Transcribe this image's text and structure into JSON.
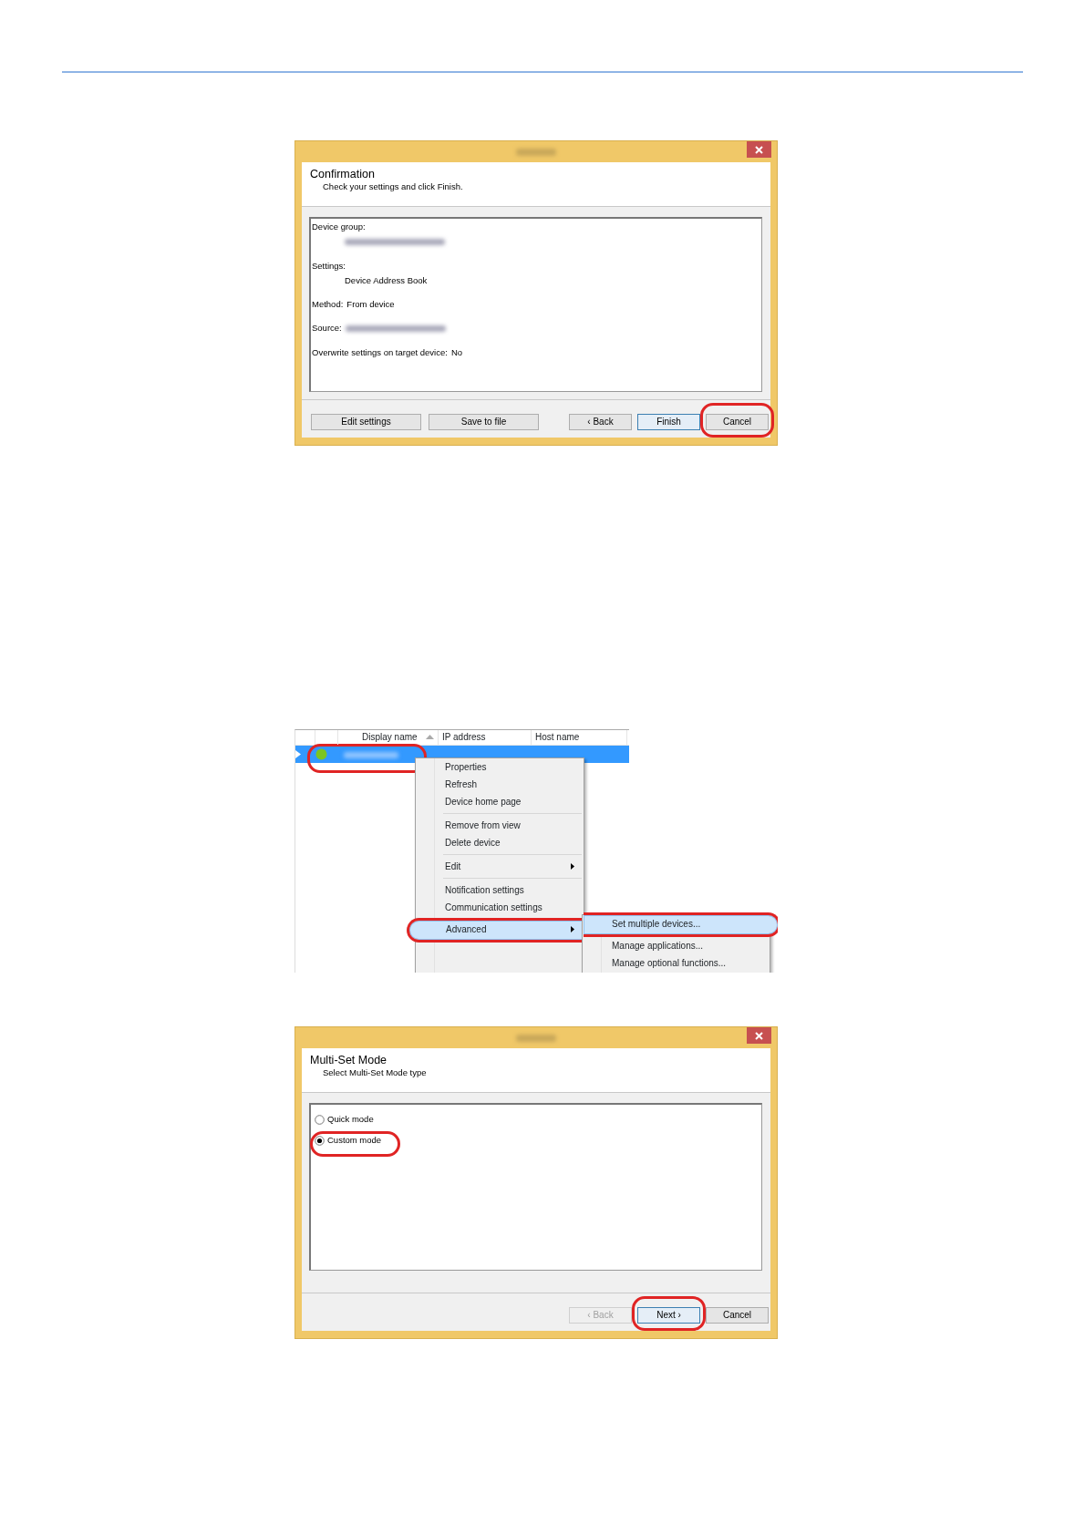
{
  "dialogs": [
    {
      "kind": "confirm",
      "heading": "Confirmation",
      "subheading": "Check your settings and click Finish.",
      "summary": [
        {
          "label": "Device group:",
          "kind": "block"
        },
        {
          "label": "Settings:",
          "kind": "block",
          "value": "Device Address Book"
        },
        {
          "label": "Method:",
          "kind": "inline",
          "value": "From device"
        },
        {
          "label": "Source:",
          "kind": "inline"
        },
        {
          "label": "Overwrite settings on target device:",
          "kind": "inline",
          "value": "No"
        }
      ],
      "buttons": [
        {
          "label": "Edit settings",
          "kind": "wide",
          "default": false,
          "disabled": false,
          "highlighted": false
        },
        {
          "label": "Save to file",
          "kind": "wide",
          "default": false,
          "disabled": false,
          "highlighted": false
        },
        {
          "label": "‹ Back",
          "kind": "nav",
          "default": false,
          "disabled": false,
          "highlighted": false
        },
        {
          "label": "Finish",
          "kind": "nav",
          "default": true,
          "disabled": false,
          "highlighted": false
        },
        {
          "label": "Cancel",
          "kind": "nav",
          "default": false,
          "disabled": false,
          "highlighted": true
        }
      ]
    },
    {
      "kind": "devices",
      "columns": [
        {
          "label": "Display name",
          "sorted": true
        },
        {
          "label": "IP address",
          "sorted": false
        },
        {
          "label": "Host name",
          "sorted": false
        }
      ],
      "rows": [
        {
          "selected": true,
          "color": "#7cc522",
          "highlighted": true
        }
      ],
      "context_menu": [
        {
          "kind": "item",
          "label": "Properties",
          "submenu": false,
          "selected": false,
          "highlighted": false
        },
        {
          "kind": "item",
          "label": "Refresh",
          "submenu": false,
          "selected": false,
          "highlighted": false
        },
        {
          "kind": "item",
          "label": "Device home page",
          "submenu": false,
          "selected": false,
          "highlighted": false
        },
        {
          "kind": "separator"
        },
        {
          "kind": "item",
          "label": "Remove from view",
          "submenu": false,
          "selected": false,
          "highlighted": false
        },
        {
          "kind": "item",
          "label": "Delete device",
          "submenu": false,
          "selected": false,
          "highlighted": false
        },
        {
          "kind": "separator"
        },
        {
          "kind": "item",
          "label": "Edit",
          "submenu": true,
          "selected": false,
          "highlighted": false
        },
        {
          "kind": "separator"
        },
        {
          "kind": "item",
          "label": "Notification settings",
          "submenu": false,
          "selected": false,
          "highlighted": false
        },
        {
          "kind": "item",
          "label": "Communication settings",
          "submenu": false,
          "selected": false,
          "highlighted": false
        },
        {
          "kind": "item",
          "label": "Advanced",
          "submenu": true,
          "selected": true,
          "highlighted": true
        }
      ],
      "submenu": [
        {
          "label": "Set multiple devices...",
          "selected": true,
          "highlighted": true
        },
        {
          "label": "Manage applications...",
          "selected": false,
          "highlighted": false
        },
        {
          "label": "Manage optional functions...",
          "selected": false,
          "highlighted": false
        }
      ]
    },
    {
      "kind": "mode",
      "heading": "Multi-Set Mode",
      "subheading": "Select Multi-Set Mode type",
      "options": [
        {
          "label": "Quick mode",
          "selected": false,
          "highlighted": false
        },
        {
          "label": "Custom mode",
          "selected": true,
          "highlighted": true
        }
      ],
      "buttons": [
        {
          "label": "‹ Back",
          "kind": "nav",
          "default": false,
          "disabled": true,
          "highlighted": false
        },
        {
          "label": "Next ›",
          "kind": "nav",
          "default": true,
          "disabled": false,
          "highlighted": true
        },
        {
          "label": "Cancel",
          "kind": "nav",
          "default": false,
          "disabled": false,
          "highlighted": false
        }
      ]
    }
  ]
}
